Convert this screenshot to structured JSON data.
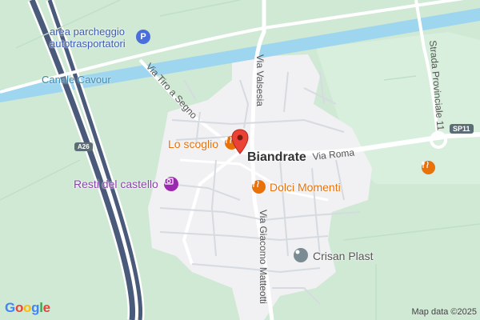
{
  "map": {
    "town": "Biandrate",
    "canal": "Canale Cavour",
    "roads": {
      "via_roma": "Via Roma",
      "via_valsesia": "Via Valsesia",
      "via_tiro_a_segno": "Via Tiro a Segno",
      "via_giacomo_matteotti": "Via Giacomo Matteotti",
      "strada_provinciale": "Strada Provinciale 11",
      "sp11_shield": "SP11",
      "a26_shield": "A26"
    },
    "pois": {
      "parking": {
        "line1": "area parcheggio",
        "line2": "autotrasportatori",
        "icon": "parking-icon",
        "color": "#4a6fdc"
      },
      "lo_scoglio": {
        "label": "Lo scoglio",
        "icon": "restaurant-icon",
        "color": "#e8710a"
      },
      "resti_castello": {
        "label": "Resti del castello",
        "icon": "camera-icon",
        "color": "#9c27b0"
      },
      "dolci_momenti": {
        "label": "Dolci Momenti",
        "icon": "restaurant-icon",
        "color": "#e8710a"
      },
      "crisan_plast": {
        "label": "Crisan Plast",
        "icon": "pin-icon",
        "color": "#7b8b93"
      },
      "restaurant_east": {
        "icon": "restaurant-icon",
        "color": "#e8710a"
      }
    },
    "marker": {
      "icon": "location-pin-icon",
      "color": "#ea4335"
    },
    "attribution": "Map data ©2025",
    "logo": "Google"
  }
}
